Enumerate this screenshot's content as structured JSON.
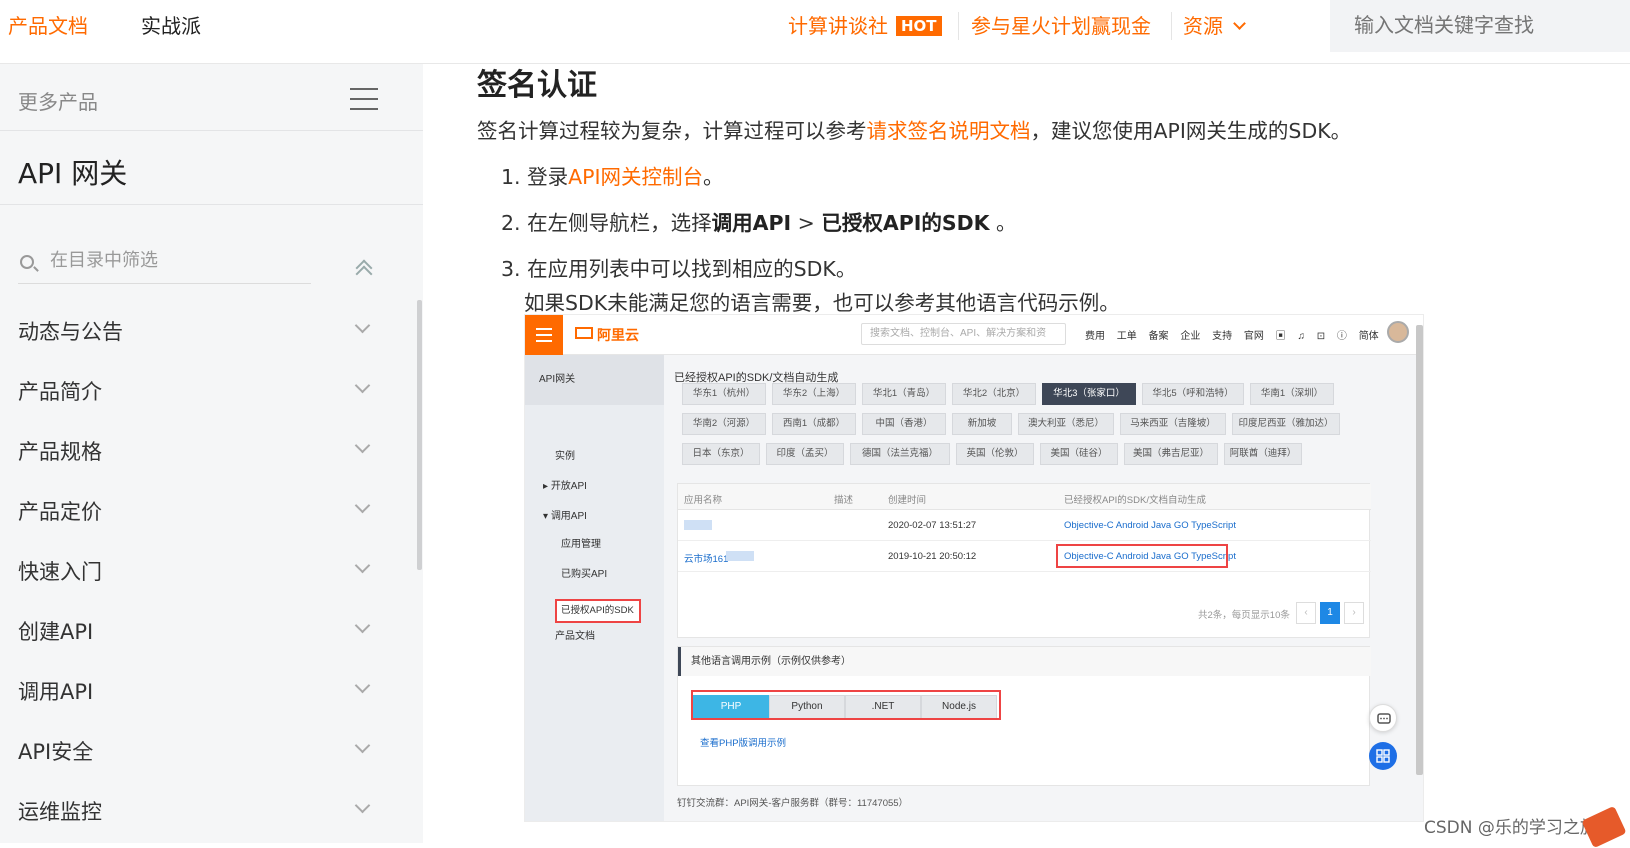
{
  "topbar": {
    "left_links": [
      "产品文档",
      "实战派"
    ],
    "right_links": {
      "talk": "计算讲谈社",
      "hot": "HOT",
      "spark": "参与星火计划赢现金",
      "resources": "资源"
    },
    "search_placeholder": "输入文档关键字查找"
  },
  "sidebar": {
    "more_products": "更多产品",
    "product_title": "API 网关",
    "filter_placeholder": "在目录中筛选",
    "items": [
      "动态与公告",
      "产品简介",
      "产品规格",
      "产品定价",
      "快速入门",
      "创建API",
      "调用API",
      "API安全",
      "运维监控"
    ]
  },
  "content": {
    "heading": "签名认证",
    "intro_before": "签名计算过程较为复杂，计算过程可以参考",
    "intro_link": "请求签名说明文档",
    "intro_after": "，建议您使用API网关生成的SDK。",
    "step1_num": "1.",
    "step1_text": "登录",
    "step1_link": "API网关控制台",
    "step1_end": "。",
    "step2_num": "2.",
    "step2_text": "在左侧导航栏，选择",
    "step2_b1": "调用API",
    "step2_sep": " > ",
    "step2_b2": "已授权API的SDK",
    "step2_end": " 。",
    "step3_num": "3.",
    "step3_text": "在应用列表中可以找到相应的SDK。",
    "step3_note": "如果SDK未能满足您的语言需要，也可以参考其他语言代码示例。"
  },
  "screenshot": {
    "logo": "阿里云",
    "search_placeholder": "搜索文档、控制台、API、解决方案和资",
    "top_links": "费用 工单 备案 企业 支持 官网",
    "lang_label": "简体",
    "side_title": "API网关",
    "side_items": {
      "instance": "实例",
      "open_api": "开放API",
      "call_api": "调用API",
      "app_mgmt": "应用管理",
      "bought": "已购买API",
      "sdk": "已授权API的SDK",
      "docs": "产品文档"
    },
    "region_title": "已经授权API的SDK/文档自动生成",
    "regions_row1": [
      "华东1（杭州）",
      "华东2（上海）",
      "华北1（青岛）",
      "华北2（北京）",
      "华北3（张家口）",
      "华北5（呼和浩特）",
      "华南1（深圳）"
    ],
    "regions_row2": [
      "华南2（河源）",
      "西南1（成都）",
      "中国（香港）",
      "新加坡",
      "澳大利亚（悉尼）",
      "马来西亚（吉隆坡）",
      "印度尼西亚（雅加达）"
    ],
    "regions_row3": [
      "日本（东京）",
      "印度（孟买）",
      "德国（法兰克福）",
      "英国（伦敦）",
      "美国（硅谷）",
      "美国（弗吉尼亚）",
      "阿联酋（迪拜）"
    ],
    "selected_region": "华北3（张家口）",
    "table_headers": [
      "应用名称",
      "描述",
      "创建时间",
      "已经授权API的SDK/文档自动生成"
    ],
    "rows": [
      {
        "name": "",
        "time": "2020-02-07 13:51:27",
        "sdk": "Objective-C Android Java GO TypeScript"
      },
      {
        "name": "云市场161",
        "time": "2019-10-21 20:50:12",
        "sdk": "Objective-C Android Java GO TypeScript"
      }
    ],
    "pagination_text": "共2条，每页显示10条",
    "page_prev": "‹",
    "page_current": "1",
    "page_next": "›",
    "lang_section_title": "其他语言调用示例（示例仅供参考）",
    "lang_tabs": [
      "PHP",
      "Python",
      ".NET",
      "Node.js"
    ],
    "lang_link": "查看PHP版调用示例",
    "footer": "钉钉交流群：API网关-客户服务群（群号：11747055）"
  },
  "watermark": "CSDN @乐的学习之旅",
  "colors": {
    "accent": "#ff6a00",
    "link_blue": "#1a6dcc",
    "highlight_red": "#e44444"
  }
}
